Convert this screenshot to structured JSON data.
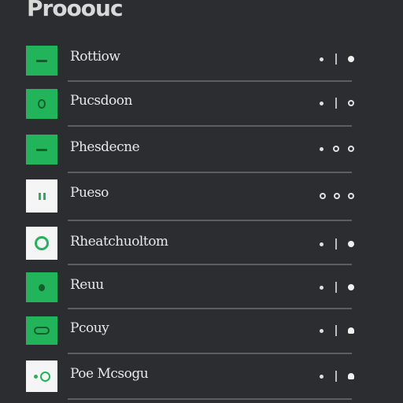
{
  "header": {
    "title": "Prooouc"
  },
  "items": [
    {
      "label": "Rottiow",
      "tile": "green",
      "glyph": "dash"
    },
    {
      "label": "Pucsdoon",
      "tile": "green",
      "glyph": "dot"
    },
    {
      "label": "Phesdecne",
      "tile": "green",
      "glyph": "dash"
    },
    {
      "label": "Pueso",
      "tile": "white",
      "glyph": "bars"
    },
    {
      "label": "Rheatchuoltom",
      "tile": "white",
      "glyph": "ring"
    },
    {
      "label": "Reuu",
      "tile": "green",
      "glyph": "dot-solid"
    },
    {
      "label": "Pcouy",
      "tile": "green",
      "glyph": "pill"
    },
    {
      "label": "Poe Mcsogu",
      "tile": "white",
      "glyph": "toggle"
    }
  ],
  "colors": {
    "accent": "#22b45a",
    "background": "#2b2d31",
    "divider": "#5b5e63"
  }
}
